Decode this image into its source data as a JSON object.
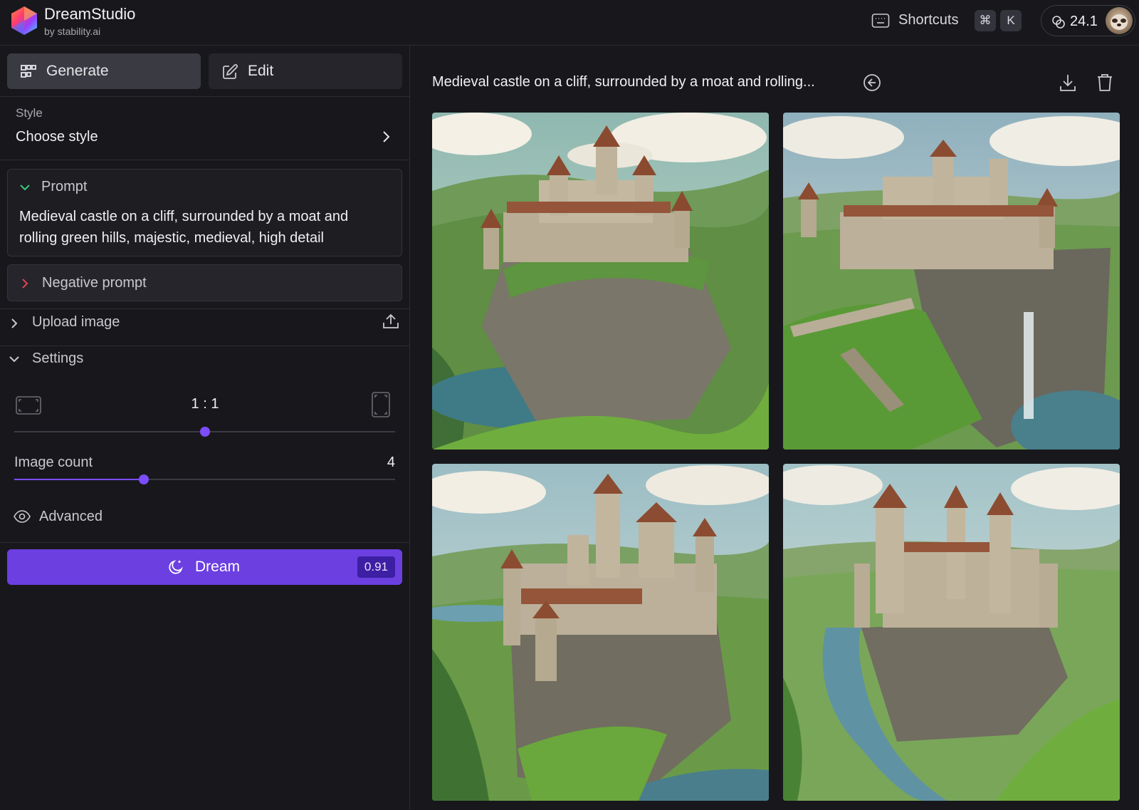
{
  "app": {
    "name": "DreamStudio",
    "subtitle": "by stability.ai"
  },
  "header": {
    "shortcuts_label": "Shortcuts",
    "shortcut_keys": [
      "⌘",
      "K"
    ],
    "credits": "24.1"
  },
  "sidebar": {
    "tabs": [
      {
        "label": "Generate",
        "active": true,
        "icon": "grid-icon"
      },
      {
        "label": "Edit",
        "active": false,
        "icon": "edit-icon"
      }
    ],
    "style": {
      "label": "Style",
      "value": "Choose style"
    },
    "prompt": {
      "title": "Prompt",
      "text": "Medieval castle on a cliff, surrounded by a moat and rolling green hills, majestic, medieval, high detail"
    },
    "negative_prompt": {
      "title": "Negative prompt"
    },
    "upload": {
      "title": "Upload image"
    },
    "settings": {
      "title": "Settings",
      "aspect_ratio": "1 : 1",
      "aspect_slider_level": 0.5,
      "image_count_label": "Image count",
      "image_count": "4",
      "image_count_slider_level": 0.34,
      "advanced_label": "Advanced"
    },
    "dream": {
      "label": "Dream",
      "cost": "0.91"
    }
  },
  "main": {
    "title": "Medieval castle on a cliff, surrounded by a moat and rolling...",
    "images": [
      {
        "alt": "castle-image-1"
      },
      {
        "alt": "castle-image-2"
      },
      {
        "alt": "castle-image-3"
      },
      {
        "alt": "castle-image-4"
      }
    ]
  },
  "colors": {
    "background": "#18181c",
    "accent": "#6b3fe0",
    "slider_accent": "#7c4dff",
    "panel": "#25252b"
  }
}
